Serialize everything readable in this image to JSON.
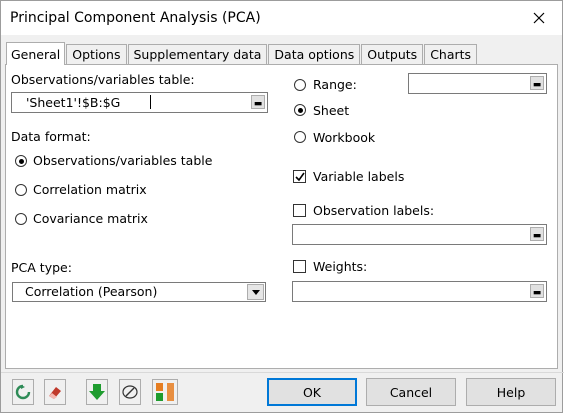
{
  "window": {
    "title": "Principal Component Analysis (PCA)"
  },
  "tabs": [
    {
      "label": "General",
      "active": true
    },
    {
      "label": "Options"
    },
    {
      "label": "Supplementary data"
    },
    {
      "label": "Data options"
    },
    {
      "label": "Outputs"
    },
    {
      "label": "Charts"
    }
  ],
  "general": {
    "obs_var_label": "Observations/variables table:",
    "obs_var_value": "'Sheet1'!$B:$G",
    "data_format_label": "Data format:",
    "data_format_options": [
      {
        "label": "Observations/variables table",
        "selected": true
      },
      {
        "label": "Correlation matrix",
        "selected": false
      },
      {
        "label": "Covariance matrix",
        "selected": false
      }
    ],
    "pca_type_label": "PCA type:",
    "pca_type_value": "Correlation (Pearson)",
    "output_options": [
      {
        "label": "Range:",
        "selected": false
      },
      {
        "label": "Sheet",
        "selected": true
      },
      {
        "label": "Workbook",
        "selected": false
      }
    ],
    "variable_labels": {
      "label": "Variable labels",
      "checked": true
    },
    "observation_labels": {
      "label": "Observation labels:",
      "checked": false
    },
    "weights": {
      "label": "Weights:",
      "checked": false
    }
  },
  "footer": {
    "ok_label": "OK",
    "cancel_label": "Cancel",
    "help_label": "Help"
  },
  "colors": {
    "default_button_border": "#0078d7",
    "reset_icon": "#2e8b57",
    "eraser_icon": "#c0392b",
    "download_icon": "#1e9c2e",
    "accent_orange": "#e67e22"
  }
}
